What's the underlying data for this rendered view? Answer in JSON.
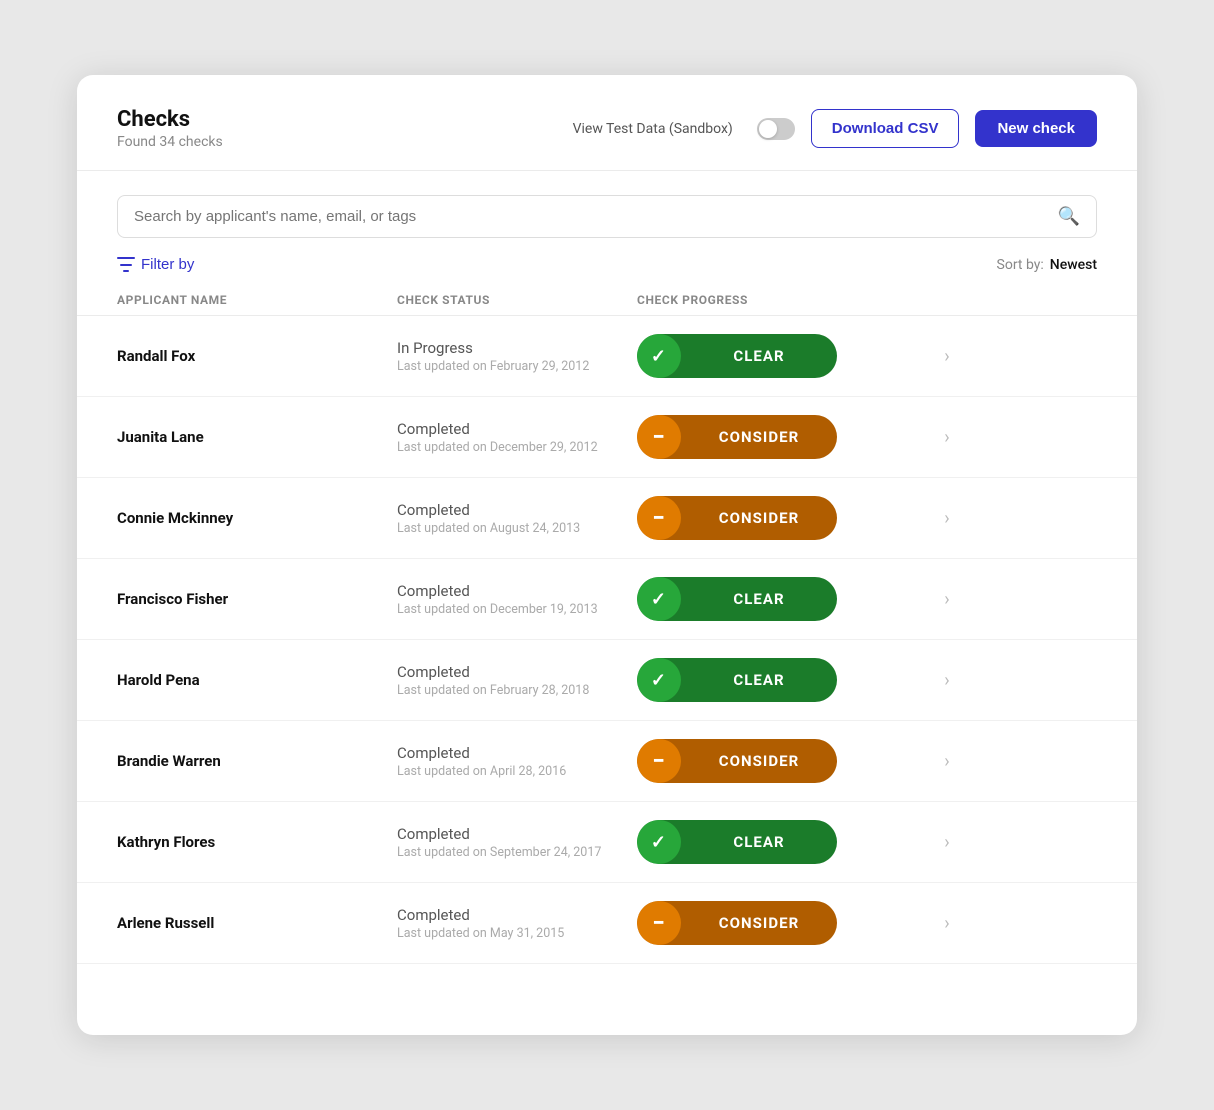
{
  "header": {
    "title": "Checks",
    "subtitle": "Found 34 checks",
    "sandbox_label": "View Test Data (Sandbox)",
    "download_btn": "Download CSV",
    "new_btn": "New check"
  },
  "search": {
    "placeholder": "Search by applicant's name, email, or tags"
  },
  "filter": {
    "label": "Filter by"
  },
  "sort": {
    "label": "Sort by:",
    "value": "Newest"
  },
  "columns": {
    "applicant": "APPLICANT NAME",
    "status": "CHECK STATUS",
    "progress": "CHECK PROGRESS"
  },
  "rows": [
    {
      "name": "Randall Fox",
      "status": "In Progress",
      "updated": "Last updated on February 29, 2012",
      "badge": "CLEAR",
      "badge_type": "clear"
    },
    {
      "name": "Juanita Lane",
      "status": "Completed",
      "updated": "Last updated on December 29, 2012",
      "badge": "CONSIDER",
      "badge_type": "consider"
    },
    {
      "name": "Connie Mckinney",
      "status": "Completed",
      "updated": "Last updated on August 24, 2013",
      "badge": "CONSIDER",
      "badge_type": "consider"
    },
    {
      "name": "Francisco Fisher",
      "status": "Completed",
      "updated": "Last updated on December 19, 2013",
      "badge": "CLEAR",
      "badge_type": "clear"
    },
    {
      "name": "Harold Pena",
      "status": "Completed",
      "updated": "Last updated on February 28, 2018",
      "badge": "CLEAR",
      "badge_type": "clear"
    },
    {
      "name": "Brandie Warren",
      "status": "Completed",
      "updated": "Last updated on April 28, 2016",
      "badge": "CONSIDER",
      "badge_type": "consider"
    },
    {
      "name": "Kathryn Flores",
      "status": "Completed",
      "updated": "Last updated on September 24, 2017",
      "badge": "CLEAR",
      "badge_type": "clear"
    },
    {
      "name": "Arlene Russell",
      "status": "Completed",
      "updated": "Last updated on May 31, 2015",
      "badge": "CONSIDER",
      "badge_type": "consider"
    }
  ]
}
